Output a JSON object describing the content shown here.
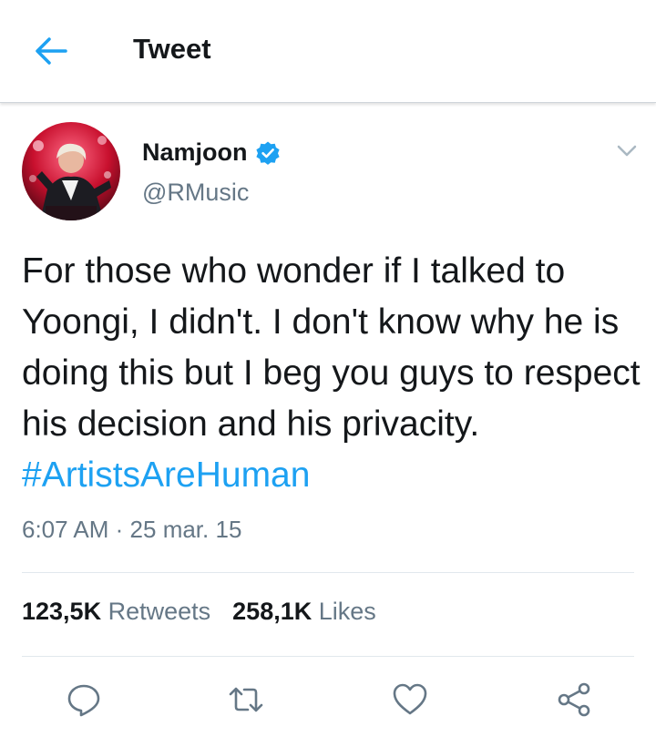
{
  "header": {
    "title": "Tweet",
    "back_icon": "arrow-left-icon"
  },
  "author": {
    "name": "Namjoon",
    "handle": "@RMusic",
    "verified_icon": "verified-badge-icon"
  },
  "tweet": {
    "text": "For those who wonder if I talked to Yoongi, I didn't. I don't know why he is doing this but I beg you guys to respect his decision and his privacity.",
    "hashtag": "#ArtistsAreHuman",
    "time": "6:07 AM",
    "separator": "·",
    "date": "25 mar. 15"
  },
  "stats": {
    "retweets_count": "123,5K",
    "retweets_label": "Retweets",
    "likes_count": "258,1K",
    "likes_label": "Likes"
  },
  "actions": [
    "reply-icon",
    "retweet-icon",
    "like-icon",
    "share-icon"
  ],
  "colors": {
    "accent": "#1da1f2",
    "text": "#14171a",
    "secondary": "#657786",
    "divider": "#e1e8ed"
  }
}
